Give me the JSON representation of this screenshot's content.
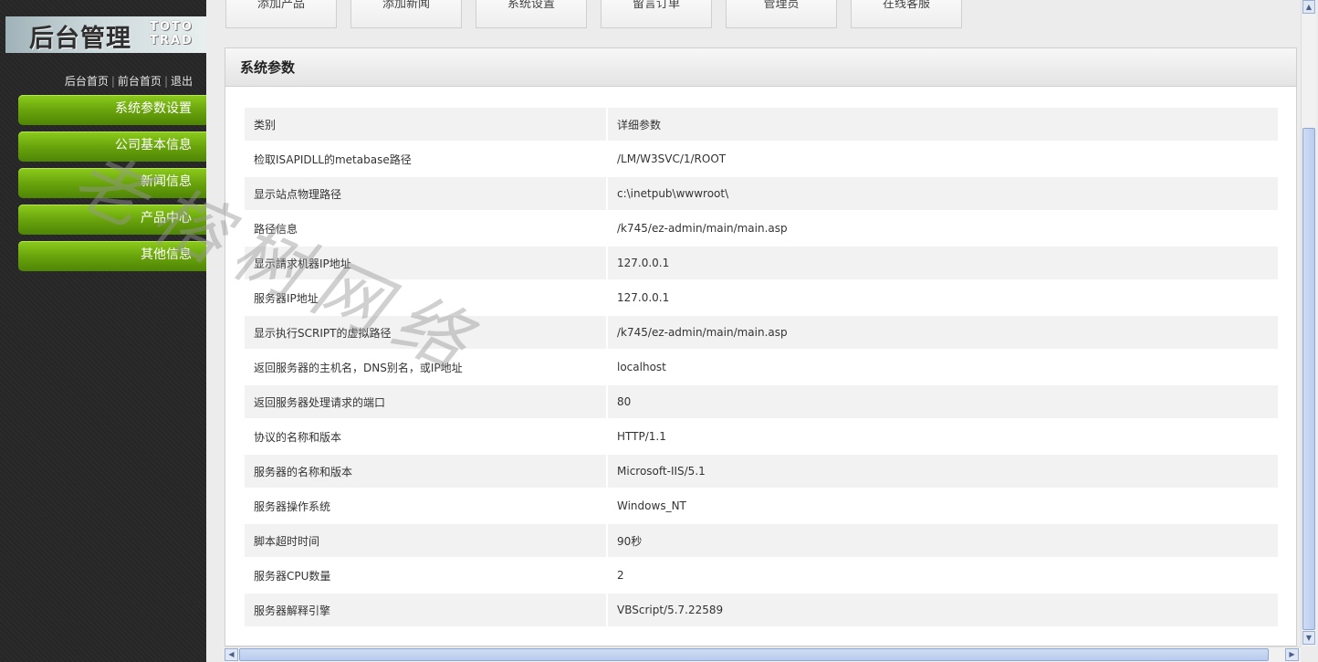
{
  "sidebar": {
    "logo_text": "后台管理",
    "logo_sub": "TOTO TRAD",
    "links": {
      "backend_home": "后台首页",
      "frontend_home": "前台首页",
      "logout": "退出",
      "separator": "|"
    },
    "menu": [
      {
        "label": "系统参数设置"
      },
      {
        "label": "公司基本信息"
      },
      {
        "label": "新闻信息"
      },
      {
        "label": "产品中心"
      },
      {
        "label": "其他信息"
      }
    ]
  },
  "topnav": [
    {
      "label": "添加产品"
    },
    {
      "label": "添加新闻"
    },
    {
      "label": "系统设置"
    },
    {
      "label": "留言订单"
    },
    {
      "label": "管理员"
    },
    {
      "label": "在线客服"
    }
  ],
  "panel": {
    "title": "系统参数",
    "header": {
      "category": "类别",
      "details": "详细参数"
    },
    "rows": [
      {
        "k": "检取ISAPIDLL的metabase路径",
        "v": "/LM/W3SVC/1/ROOT"
      },
      {
        "k": "显示站点物理路径",
        "v": "c:\\inetpub\\wwwroot\\"
      },
      {
        "k": "路径信息",
        "v": "/k745/ez-admin/main/main.asp"
      },
      {
        "k": "显示請求机器IP地址",
        "v": "127.0.0.1"
      },
      {
        "k": "服务器IP地址",
        "v": "127.0.0.1"
      },
      {
        "k": "显示执行SCRIPT的虚拟路径",
        "v": "/k745/ez-admin/main/main.asp"
      },
      {
        "k": "返回服务器的主机名，DNS别名，或IP地址",
        "v": "localhost"
      },
      {
        "k": "返回服务器处理请求的端口",
        "v": "80"
      },
      {
        "k": "协议的名称和版本",
        "v": "HTTP/1.1"
      },
      {
        "k": "服务器的名称和版本",
        "v": "Microsoft-IIS/5.1"
      },
      {
        "k": "服务器操作系统",
        "v": "Windows_NT"
      },
      {
        "k": "脚本超时时间",
        "v": "90秒"
      },
      {
        "k": "服务器CPU数量",
        "v": "2"
      },
      {
        "k": "服务器解释引擎",
        "v": "VBScript/5.7.22589"
      }
    ]
  },
  "watermark": "老榕树网络",
  "colors": {
    "menu_green": "#6aa40c",
    "sidebar_bg": "#2b2b2b",
    "page_bg": "#ececec"
  }
}
